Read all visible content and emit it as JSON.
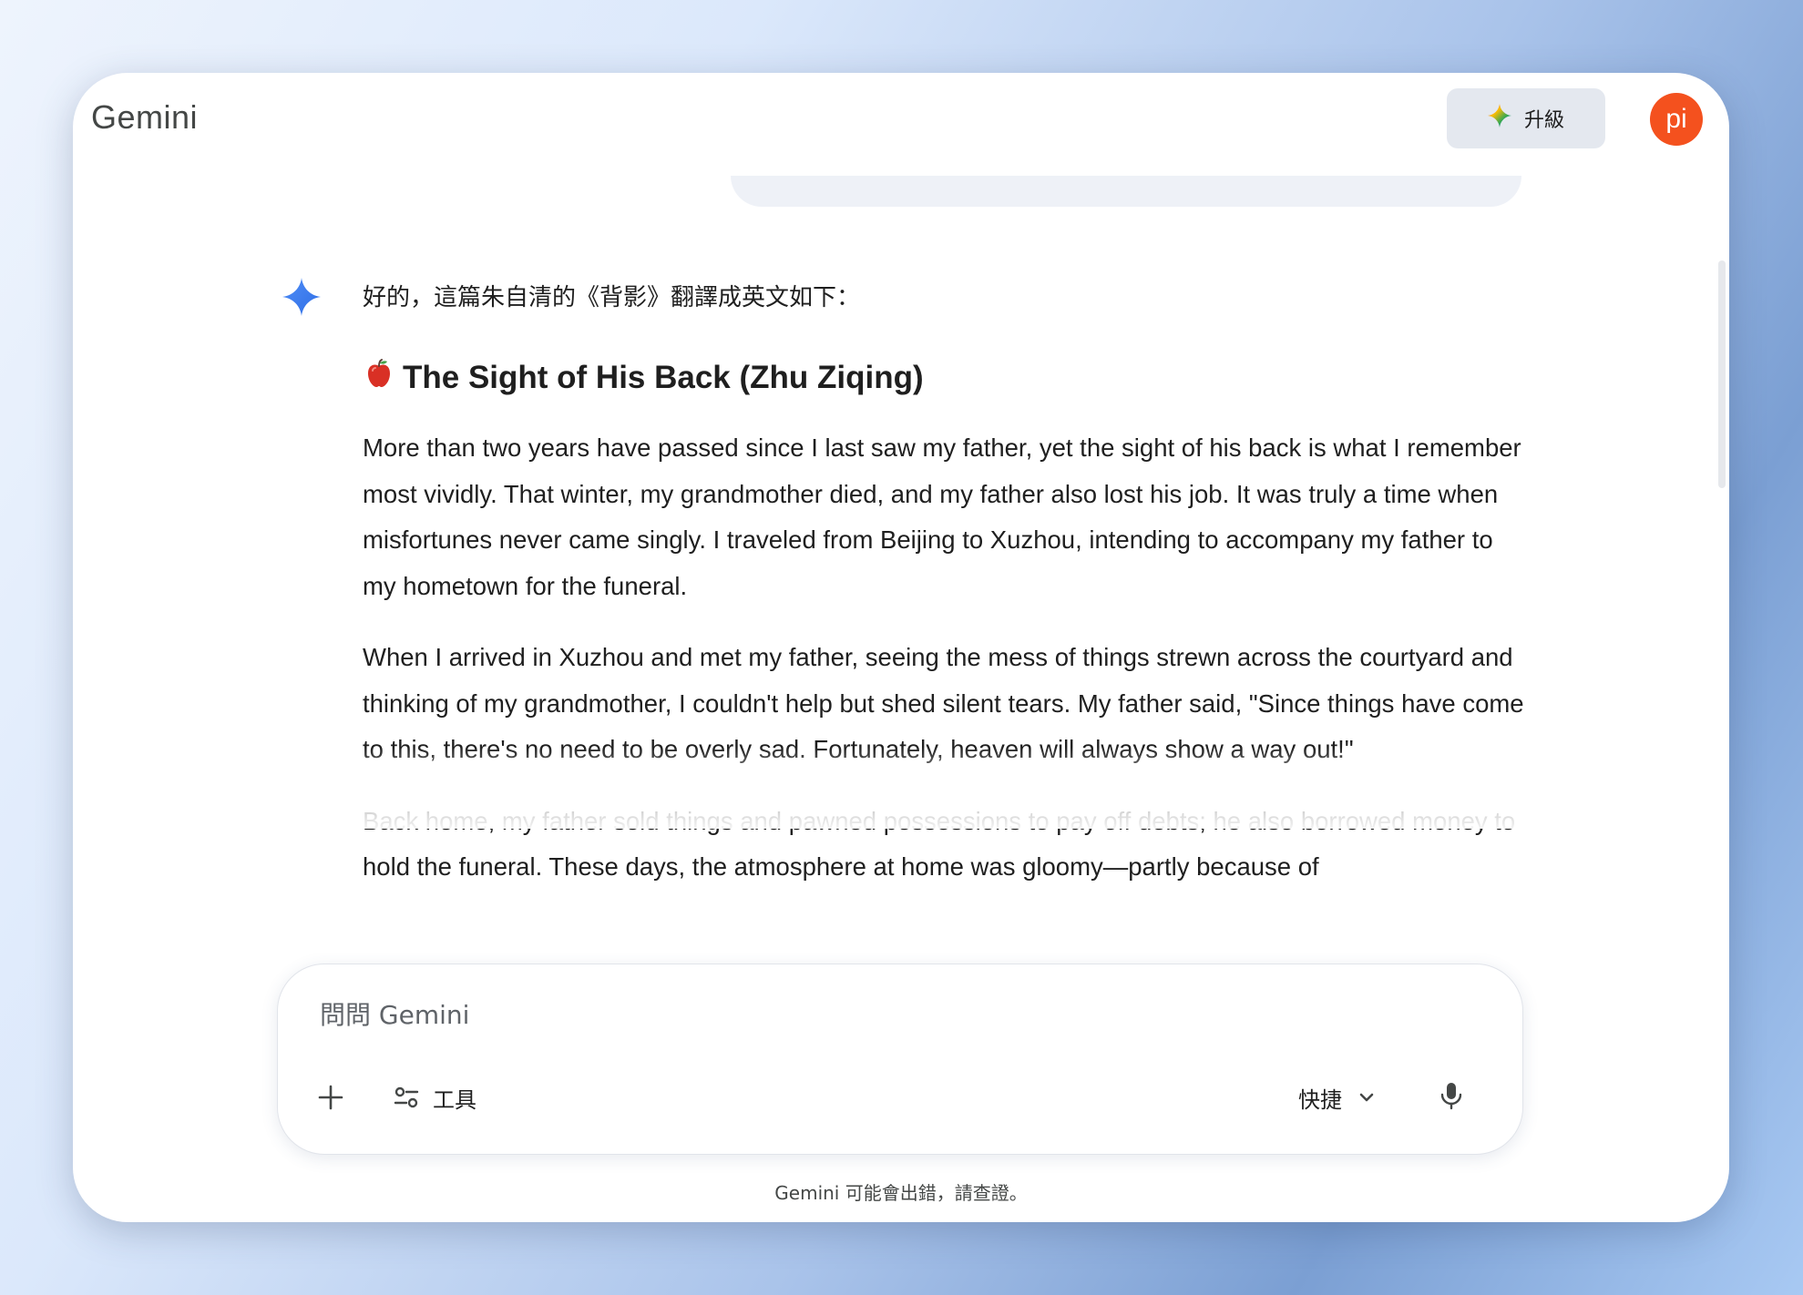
{
  "header": {
    "brand": "Gemini",
    "upgrade_label": "升級",
    "avatar_text": "pi"
  },
  "conversation": {
    "intro": "好的，這篇朱自清的《背影》翻譯成英文如下：",
    "heading": "The Sight of His Back (Zhu Ziqing)",
    "paragraphs": [
      "More than two years have passed since I last saw my father, yet the sight of his back is what I remember most vividly. That winter, my grandmother died, and my father also lost his job. It was truly a time when misfortunes never came singly. I traveled from Beijing to Xuzhou, intending to accompany my father to my hometown for the funeral.",
      "When I arrived in Xuzhou and met my father, seeing the mess of things strewn across the courtyard and thinking of my grandmother, I couldn't help but shed silent tears. My father said, \"Since things have come to this, there's no need to be overly sad. Fortunately, heaven will always show a way out!\"",
      "Back home, my father sold things and pawned possessions to pay off debts; he also borrowed money to hold the funeral. These days, the atmosphere at home was gloomy—partly because of"
    ]
  },
  "composer": {
    "placeholder": "問問 Gemini",
    "tools_label": "工具",
    "mode_label": "快捷"
  },
  "footer": {
    "disclaimer": "Gemini 可能會出錯，請查證。"
  },
  "icons": {
    "upgrade": "gemini-spark-icon",
    "response": "gemini-spark-icon",
    "heading": "red-apple-icon",
    "add": "plus-icon",
    "tools": "tools-sliders-icon",
    "mode": "chevron-down-icon",
    "mic": "microphone-icon"
  },
  "colors": {
    "avatar": "#f4511e",
    "spark": "#4285f4",
    "upgrade_bg": "#e4e8ef"
  }
}
